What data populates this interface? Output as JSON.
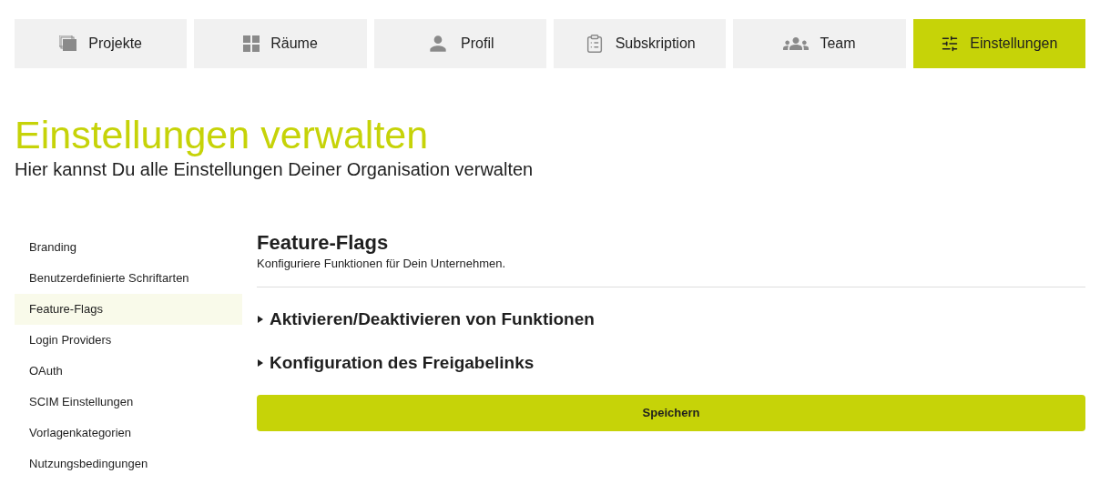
{
  "tabs": [
    {
      "label": "Projekte",
      "selected": false
    },
    {
      "label": "Räume",
      "selected": false
    },
    {
      "label": "Profil",
      "selected": false
    },
    {
      "label": "Subskription",
      "selected": false
    },
    {
      "label": "Team",
      "selected": false
    },
    {
      "label": "Einstellungen",
      "selected": true
    }
  ],
  "page": {
    "title": "Einstellungen verwalten",
    "subtitle": "Hier kannst Du alle Einstellungen Deiner Organisation verwalten"
  },
  "sidebar": {
    "items": [
      {
        "label": "Branding",
        "selected": false
      },
      {
        "label": "Benutzerdefinierte Schriftarten",
        "selected": false
      },
      {
        "label": "Feature-Flags",
        "selected": true
      },
      {
        "label": "Login Providers",
        "selected": false
      },
      {
        "label": "OAuth",
        "selected": false
      },
      {
        "label": "SCIM Einstellungen",
        "selected": false
      },
      {
        "label": "Vorlagenkategorien",
        "selected": false
      },
      {
        "label": "Nutzungsbedingungen",
        "selected": false
      }
    ]
  },
  "content": {
    "heading": "Feature-Flags",
    "description": "Konfiguriere Funktionen für Dein Unternehmen.",
    "sections": [
      {
        "label": "Aktivieren/Deaktivieren von Funktionen",
        "expanded": false
      },
      {
        "label": "Konfiguration des Freigabelinks",
        "expanded": false
      }
    ],
    "save_button": "Speichern"
  }
}
